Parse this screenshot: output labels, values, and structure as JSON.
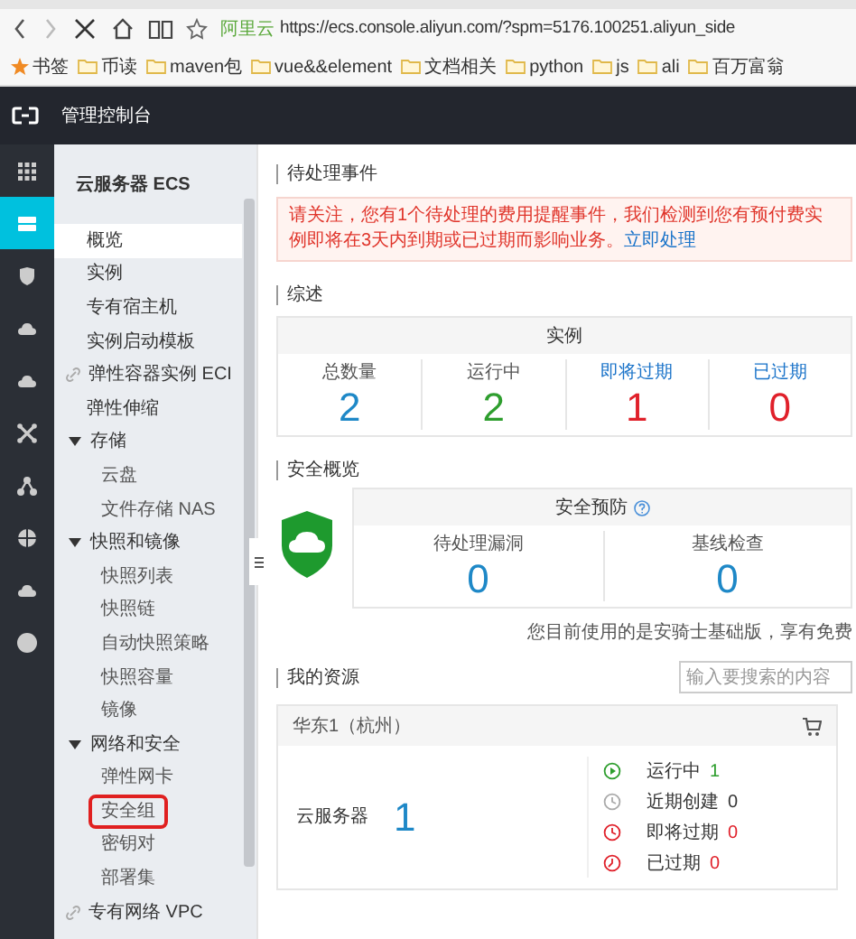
{
  "browser": {
    "site_label": "阿里云",
    "url": "https://ecs.console.aliyun.com/?spm=5176.100251.aliyun_side",
    "bookmarks": [
      {
        "label": "书签",
        "kind": "star"
      },
      {
        "label": "币读",
        "kind": "folder"
      },
      {
        "label": "maven包",
        "kind": "folder"
      },
      {
        "label": "vue&&element",
        "kind": "folder"
      },
      {
        "label": "文档相关",
        "kind": "folder"
      },
      {
        "label": "python",
        "kind": "folder"
      },
      {
        "label": "js",
        "kind": "folder"
      },
      {
        "label": "ali",
        "kind": "folder"
      },
      {
        "label": "百万富翁",
        "kind": "folder"
      }
    ]
  },
  "header": {
    "title": "管理控制台"
  },
  "nav_icons": [
    {
      "kind": "grid",
      "selected": false
    },
    {
      "kind": "server",
      "selected": true
    },
    {
      "kind": "shield",
      "selected": false
    },
    {
      "kind": "cloud",
      "selected": false
    },
    {
      "kind": "cloud",
      "selected": false
    },
    {
      "kind": "network",
      "selected": false
    },
    {
      "kind": "nodes",
      "selected": false
    },
    {
      "kind": "globe",
      "selected": false
    },
    {
      "kind": "cloud",
      "selected": false
    },
    {
      "kind": "dot",
      "selected": false
    }
  ],
  "sidebar": {
    "title": "云服务器 ECS",
    "items": [
      {
        "label": "概览",
        "kind": "item",
        "selected": true,
        "highlighted": false
      },
      {
        "label": "实例",
        "kind": "item",
        "selected": false,
        "highlighted": false
      },
      {
        "label": "专有宿主机",
        "kind": "item",
        "selected": false,
        "highlighted": false
      },
      {
        "label": "实例启动模板",
        "kind": "item",
        "selected": false,
        "highlighted": false
      },
      {
        "label": "弹性容器实例 ECI",
        "kind": "link",
        "selected": false,
        "highlighted": false
      },
      {
        "label": "弹性伸缩",
        "kind": "item",
        "selected": false,
        "highlighted": false
      },
      {
        "label": "存储",
        "kind": "group",
        "expanded": true,
        "children": [
          {
            "label": "云盘",
            "kind": "item",
            "selected": false,
            "highlighted": false
          },
          {
            "label": "文件存储 NAS",
            "kind": "item",
            "selected": false,
            "highlighted": false
          }
        ]
      },
      {
        "label": "快照和镜像",
        "kind": "group",
        "expanded": true,
        "children": [
          {
            "label": "快照列表",
            "kind": "item",
            "selected": false,
            "highlighted": false
          },
          {
            "label": "快照链",
            "kind": "item",
            "selected": false,
            "highlighted": false
          },
          {
            "label": "自动快照策略",
            "kind": "item",
            "selected": false,
            "highlighted": false
          },
          {
            "label": "快照容量",
            "kind": "item",
            "selected": false,
            "highlighted": false
          },
          {
            "label": "镜像",
            "kind": "item",
            "selected": false,
            "highlighted": false
          }
        ]
      },
      {
        "label": "网络和安全",
        "kind": "group",
        "expanded": true,
        "children": [
          {
            "label": "弹性网卡",
            "kind": "item",
            "selected": false,
            "highlighted": false
          },
          {
            "label": "安全组",
            "kind": "item",
            "selected": false,
            "highlighted": true
          },
          {
            "label": "密钥对",
            "kind": "item",
            "selected": false,
            "highlighted": false
          },
          {
            "label": "部署集",
            "kind": "item",
            "selected": false,
            "highlighted": false
          }
        ]
      },
      {
        "label": "专有网络 VPC",
        "kind": "link",
        "selected": false,
        "highlighted": false
      }
    ]
  },
  "pending": {
    "title": "待处理事件",
    "message": "请关注，您有1个待处理的费用提醒事件，我们检测到您有预付费实例即将在3天内到期或已过期",
    "message_end": "而影响业务。",
    "action": "立即处理"
  },
  "overview": {
    "title": "综述",
    "card_title": "实例",
    "stats": [
      {
        "label": "总数量",
        "link": false,
        "value": "2",
        "color": "#1e88c7"
      },
      {
        "label": "运行中",
        "link": false,
        "value": "2",
        "color": "#2e9e2e"
      },
      {
        "label": "即将过期",
        "link": true,
        "value": "1",
        "color": "#e0202a"
      },
      {
        "label": "已过期",
        "link": true,
        "value": "0",
        "color": "#e0202a"
      }
    ]
  },
  "security": {
    "title": "安全概览",
    "card_title": "安全预防",
    "stats": [
      {
        "label": "待处理漏洞",
        "value": "0"
      },
      {
        "label": "基线检查",
        "value": "0"
      }
    ],
    "note": "您目前使用的是安骑士基础版，享有免费"
  },
  "resources": {
    "title": "我的资源",
    "search": {
      "placeholder": "输入要搜索的内容"
    },
    "region": "华东1（杭州）",
    "product": "云服务器",
    "count": "1",
    "statuses": [
      {
        "label": "运行中",
        "value": "1",
        "kind": "running",
        "color": "#2e9e2e"
      },
      {
        "label": "近期创建",
        "value": "0",
        "kind": "recent",
        "color": "#333333"
      },
      {
        "label": "即将过期",
        "value": "0",
        "kind": "expiring",
        "color": "#e0202a"
      },
      {
        "label": "已过期",
        "value": "0",
        "kind": "expired",
        "color": "#e0202a"
      }
    ]
  }
}
